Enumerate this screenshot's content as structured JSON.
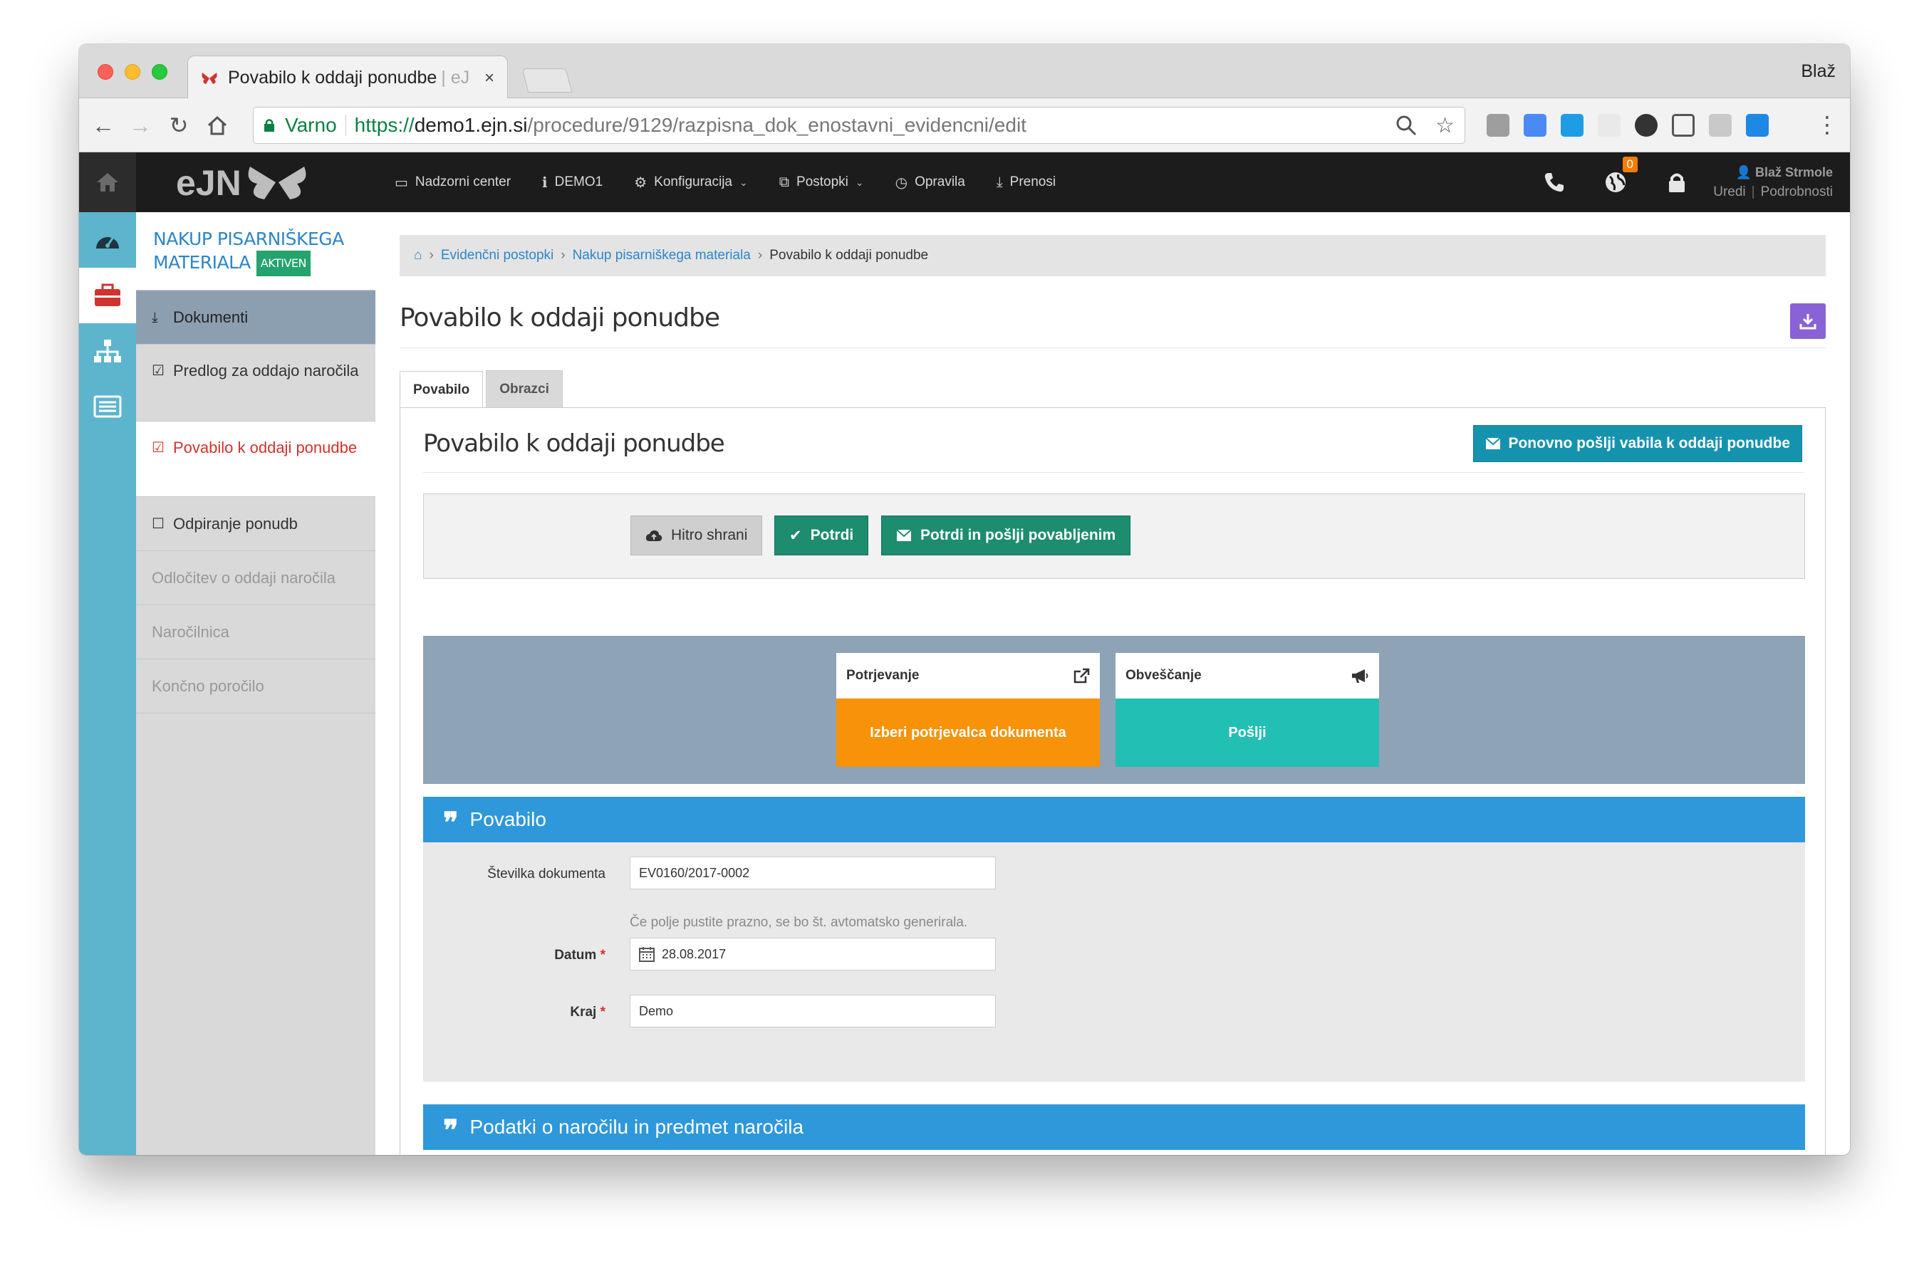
{
  "browser": {
    "tab_title": "Povabilo k oddaji ponudbe",
    "tab_title_suffix": "| eJ",
    "tab_close": "×",
    "profile_name": "Blaž",
    "secure_label": "Varno",
    "url_scheme": "https://",
    "url_host": "demo1.ejn.si",
    "url_path": "/procedure/9129/razpisna_dok_enostavni_evidencni/edit"
  },
  "header": {
    "nav": [
      {
        "label": "Nadzorni center",
        "icon": "monitor-icon"
      },
      {
        "label": "DEMO1",
        "icon": "info-icon"
      },
      {
        "label": "Konfiguracija",
        "icon": "gears-icon"
      },
      {
        "label": "Postopki",
        "icon": "sitemap-icon"
      },
      {
        "label": "Opravila",
        "icon": "clock-icon"
      },
      {
        "label": "Prenosi",
        "icon": "download-icon"
      }
    ],
    "notification_count": "0",
    "user_name": "Blaž Strmole",
    "user_edit": "Uredi",
    "user_sep": "|",
    "user_details": "Podrobnosti"
  },
  "sidebar": {
    "procedure_title": "NAKUP PISARNIŠKEGA MATERIALA",
    "procedure_badge": "AKTIVEN",
    "items": [
      {
        "label": "Dokumenti"
      },
      {
        "label": "Predlog za oddajo naročila"
      },
      {
        "label": "Povabilo k oddaji ponudbe"
      },
      {
        "label": "Odpiranje ponudb"
      },
      {
        "label": "Odločitev o oddaji naročila"
      },
      {
        "label": "Naročilnica"
      },
      {
        "label": "Končno poročilo"
      }
    ]
  },
  "breadcrumb": {
    "items": [
      "Evidenčni postopki",
      "Nakup pisarniškega materiala",
      "Povabilo k oddaji ponudbe"
    ],
    "sep": "›"
  },
  "page": {
    "title": "Povabilo k oddaji ponudbe",
    "tabs": [
      "Povabilo",
      "Obrazci"
    ],
    "section_title": "Povabilo k oddaji ponudbe",
    "resend_label": "Ponovno pošlji vabila k oddaji ponudbe"
  },
  "actions": {
    "quick_save": "Hitro shrani",
    "confirm": "Potrdi",
    "confirm_send": "Potrdi in pošlji povabljenim"
  },
  "cards": {
    "approval_title": "Potrjevanje",
    "approval_action": "Izberi potrjevalca dokumenta",
    "notify_title": "Obveščanje",
    "notify_action": "Pošlji"
  },
  "form": {
    "heading": "Povabilo",
    "doc_number_label": "Številka dokumenta",
    "doc_number_value": "EV0160/2017-0002",
    "doc_number_help": "Če polje pustite prazno, se bo št. avtomatsko generirala.",
    "date_label": "Datum",
    "date_value": "28.08.2017",
    "place_label": "Kraj",
    "place_value": "Demo",
    "required_mark": "*"
  },
  "section2": {
    "heading": "Podatki o naročilu in predmet naročila"
  },
  "colors": {
    "accent_blue": "#2e98db",
    "rail_teal": "#5cb4cd",
    "confirm_green": "#1d8c6f",
    "orange": "#f79209",
    "teal_card": "#22bfb4",
    "purple": "#8a62d6",
    "danger_red": "#d2322d"
  }
}
